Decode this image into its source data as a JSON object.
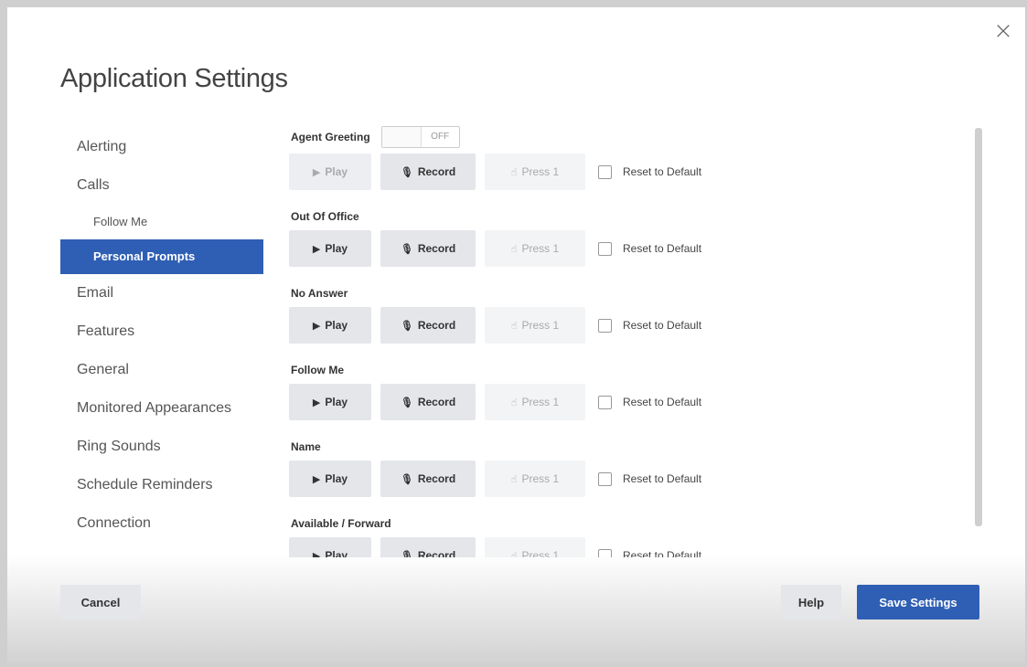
{
  "dialog": {
    "title": "Application Settings",
    "close_symbol": "×"
  },
  "nav": {
    "items": [
      {
        "label": "Alerting"
      },
      {
        "label": "Calls"
      },
      {
        "label": "Follow Me"
      },
      {
        "label": "Personal Prompts"
      },
      {
        "label": "Email"
      },
      {
        "label": "Features"
      },
      {
        "label": "General"
      },
      {
        "label": "Monitored Appearances"
      },
      {
        "label": "Ring Sounds"
      },
      {
        "label": "Schedule Reminders"
      },
      {
        "label": "Connection"
      }
    ],
    "active": "Personal Prompts"
  },
  "prompts": {
    "agent_greeting": {
      "label": "Agent Greeting",
      "toggle_state": "OFF"
    },
    "out_of_office": {
      "label": "Out Of Office"
    },
    "no_answer": {
      "label": "No Answer"
    },
    "follow_me": {
      "label": "Follow Me"
    },
    "name": {
      "label": "Name"
    },
    "available_forward": {
      "label": "Available / Forward"
    }
  },
  "buttons": {
    "play": "Play",
    "record": "Record",
    "press1": "Press 1",
    "reset": "Reset to Default"
  },
  "icons": {
    "play": "play-icon",
    "record": "microphone-icon",
    "press": "touch-icon"
  },
  "footer": {
    "cancel": "Cancel",
    "help": "Help",
    "save": "Save Settings"
  },
  "colors": {
    "accent": "#2f5fb4"
  }
}
